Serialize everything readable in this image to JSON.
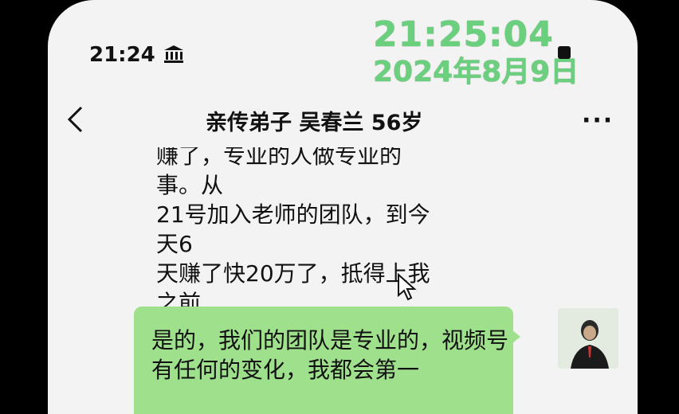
{
  "status_bar": {
    "time": "21:24"
  },
  "overlay": {
    "time": "21:25:04",
    "date": "2024年8月9日"
  },
  "chat": {
    "title": "亲传弟子 吴春兰 56岁"
  },
  "messages": {
    "incoming_text": "赚了，专业的人做专业的事。从\n21号加入老师的团队，到今天6\n天赚了快20万了，抵得上我之前\n四五年的工资了",
    "outgoing_text": "是的，我们的团队是专业的，视频号有任何的变化，我都会第一"
  },
  "icons": {
    "status": "bank-icon",
    "back": "chevron-left-icon",
    "more": "more-dots-icon",
    "emoji": "grin-emoji-icon",
    "cursor": "mouse-pointer-icon"
  },
  "colors": {
    "background": "#f3f3f3",
    "outgoing_bubble": "#9fe08d",
    "overlay_text": "#6bd07e"
  }
}
